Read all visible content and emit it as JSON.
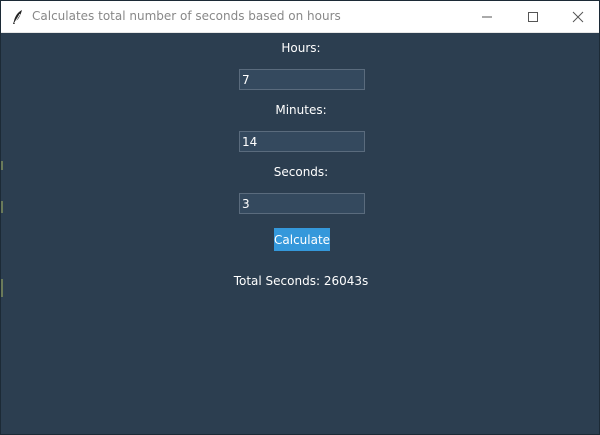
{
  "window": {
    "title": "Calculates total number of seconds based on hours",
    "icon": "feather-icon",
    "controls": [
      "minimize-icon",
      "maximize-icon",
      "close-icon"
    ]
  },
  "form": {
    "hours_label": "Hours:",
    "hours_value": "7",
    "minutes_label": "Minutes:",
    "minutes_value": "14",
    "seconds_label": "Seconds:",
    "seconds_value": "3",
    "calculate_label": "Calculate",
    "result_text": "Total Seconds: 26043s"
  },
  "colors": {
    "background": "#2c3e50",
    "entry_background": "#34495e",
    "button_accent": "#3498db",
    "text": "#ffffff"
  }
}
